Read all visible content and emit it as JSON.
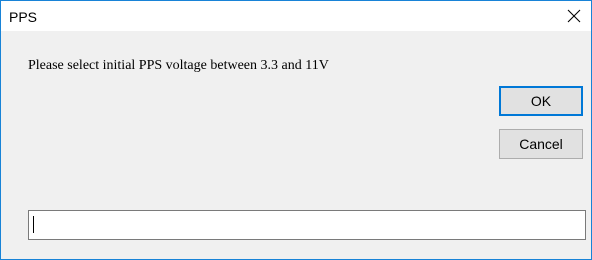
{
  "window": {
    "title": "PPS",
    "close_icon": "close-icon",
    "border_color": "#1883d7"
  },
  "prompt": {
    "text": "Please select initial PPS voltage between 3.3 and 11V"
  },
  "buttons": {
    "ok_label": "OK",
    "cancel_label": "Cancel",
    "default_border_color": "#0078d7"
  },
  "input": {
    "value": "",
    "placeholder": ""
  }
}
